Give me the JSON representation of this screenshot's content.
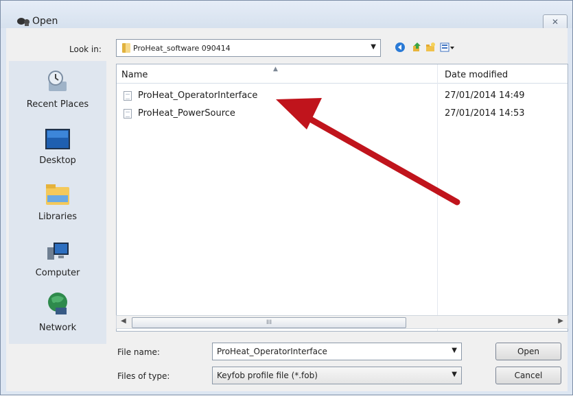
{
  "window": {
    "title": "Open",
    "close_glyph": "✕"
  },
  "toolbar": {
    "look_in_label": "Look in:",
    "look_in_value": "ProHeat_software 090414",
    "icons": [
      "back-icon",
      "up-folder-icon",
      "new-folder-icon",
      "views-menu-icon"
    ]
  },
  "places": [
    {
      "label": "Recent Places",
      "icon": "recent-places-icon"
    },
    {
      "label": "Desktop",
      "icon": "desktop-icon"
    },
    {
      "label": "Libraries",
      "icon": "libraries-icon"
    },
    {
      "label": "Computer",
      "icon": "computer-icon"
    },
    {
      "label": "Network",
      "icon": "network-icon"
    }
  ],
  "file_list": {
    "columns": {
      "name": "Name",
      "date_modified": "Date modified"
    },
    "rows": [
      {
        "name": "ProHeat_OperatorInterface",
        "date": "27/01/2014 14:49"
      },
      {
        "name": "ProHeat_PowerSource",
        "date": "27/01/2014 14:53"
      }
    ],
    "scroll_thumb_grip": "III"
  },
  "form": {
    "file_name_label": "File name:",
    "file_name_value": "ProHeat_OperatorInterface",
    "file_type_label": "Files of type:",
    "file_type_value": "Keyfob profile file (*.fob)",
    "open_label": "Open",
    "cancel_label": "Cancel"
  },
  "annotation": {
    "color": "#c0141c",
    "icon": "red-pointer-arrow"
  },
  "colors": {
    "panel": "#f0f0f0",
    "places_pane": "#dfe6ef",
    "titlebar": "#dde6f2"
  }
}
